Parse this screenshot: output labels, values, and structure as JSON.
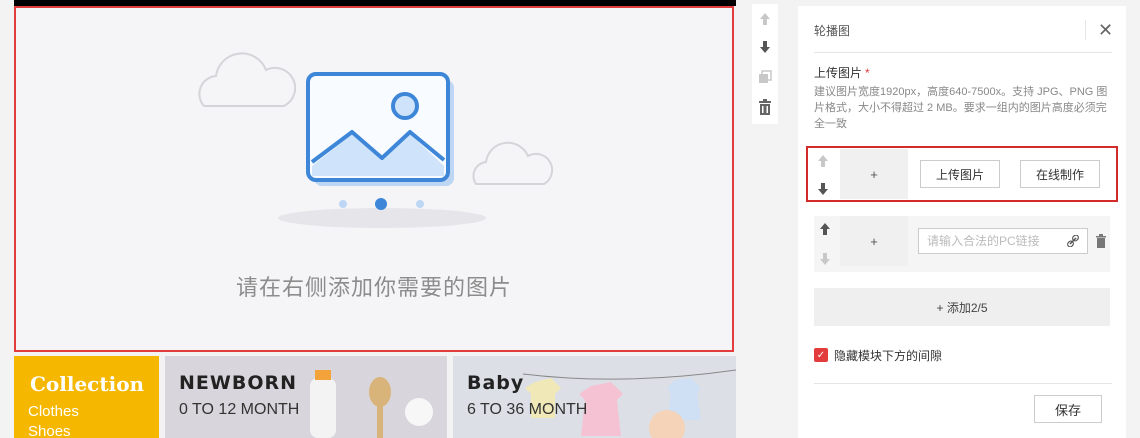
{
  "carousel": {
    "hint": "请在右侧添加你需要的图片"
  },
  "banners": [
    {
      "title": "Collection",
      "sub1": "Clothes",
      "sub2": "Shoes"
    },
    {
      "title": "NEWBORN",
      "sub": "0 TO 12 MONTH"
    },
    {
      "title": "Baby",
      "sub": "6 TO 36 MONTH"
    }
  ],
  "tools": {
    "up": "move-up-icon",
    "down": "move-down-icon",
    "copy": "copy-icon",
    "delete": "trash-icon"
  },
  "panel": {
    "title": "轮播图",
    "upload_label": "上传图片",
    "required_mark": "*",
    "description": "建议图片宽度1920px，高度640-7500x。支持 JPG、PNG 图片格式，大小不得超过 2 MB。要求一组内的图片高度必须完全一致",
    "row1": {
      "thumb": "+",
      "upload_button": "上传图片",
      "online_button": "在线制作"
    },
    "row2": {
      "thumb": "+",
      "link_placeholder": "请输入合法的PC链接"
    },
    "add_button": "+ 添加2/5",
    "hide_gap_label": "隐藏模块下方的间隙",
    "save_button": "保存"
  },
  "colors": {
    "accent": "#e23c3c",
    "banner_yellow": "#f6b700",
    "illustration_blue": "#3d86d8"
  }
}
